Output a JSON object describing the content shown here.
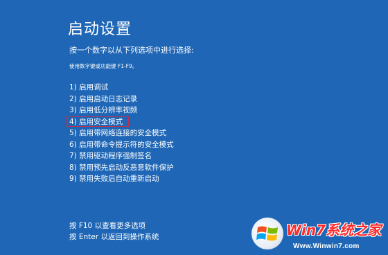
{
  "title": "启动设置",
  "subtitle": "按一个数字以从下列选项中进行选择:",
  "hint": "使用数字键或功能键 F1-F9。",
  "options": [
    {
      "label": "1) 启用调试"
    },
    {
      "label": "2) 启用启动日志记录"
    },
    {
      "label": "3) 启用低分辨率视频"
    },
    {
      "label": "4) 启用安全模式",
      "selected": true
    },
    {
      "label": "5) 启用带网络连接的安全模式"
    },
    {
      "label": "6) 启用带命令提示符的安全模式"
    },
    {
      "label": "7) 禁用驱动程序强制签名"
    },
    {
      "label": "8) 禁用预先启动反恶意软件保护"
    },
    {
      "label": "9) 禁用失败后自动重新启动"
    }
  ],
  "footer": {
    "more_options": "按 F10 以查看更多选项",
    "return": "按 Enter 以返回到操作系统"
  },
  "watermark": {
    "brand": "Win7系统之家",
    "url": "Www.Winwin7.com"
  },
  "colors": {
    "background": "#1f67b6",
    "selection_border": "#c0304a"
  }
}
